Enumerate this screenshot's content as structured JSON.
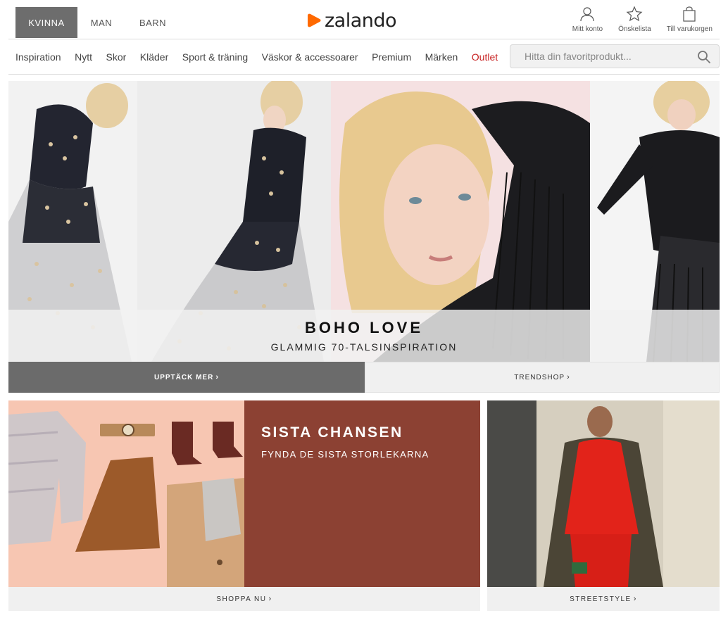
{
  "header": {
    "gender_tabs": [
      {
        "label": "KVINNA",
        "active": true
      },
      {
        "label": "MAN",
        "active": false
      },
      {
        "label": "BARN",
        "active": false
      }
    ],
    "logo_text": "zalando",
    "account_links": {
      "account": "Mitt konto",
      "wishlist": "Önskelista",
      "cart": "Till varukorgen"
    }
  },
  "nav": {
    "items": [
      "Inspiration",
      "Nytt",
      "Skor",
      "Kläder",
      "Sport & träning",
      "Väskor & accessoarer",
      "Premium",
      "Märken",
      "Outlet"
    ],
    "search_placeholder": "Hitta din favoritprodukt..."
  },
  "hero": {
    "title": "BOHO LOVE",
    "subtitle": "GLAMMIG 70-TALSINSPIRATION",
    "cta_primary": "UPPTÄCK MER",
    "cta_secondary": "TRENDSHOP"
  },
  "promo_left": {
    "title": "SISTA CHANSEN",
    "subtitle": "FYNDA DE SISTA STORLEKARNA",
    "cta": "SHOPPA NU"
  },
  "promo_right": {
    "cta": "STREETSTYLE"
  },
  "colors": {
    "accent_orange": "#ff6900",
    "outlet_red": "#c71f1f",
    "promo_brown": "#8c4133",
    "active_tab": "#6d6d6d"
  },
  "icons": {
    "account": "user-icon",
    "wishlist": "star-icon",
    "cart": "shopping-bag-icon",
    "search": "search-icon",
    "chevron": "chevron-right-icon"
  }
}
